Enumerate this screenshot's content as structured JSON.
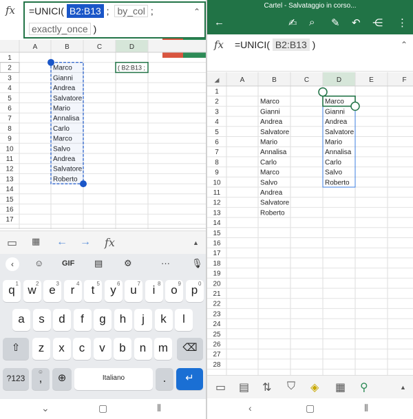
{
  "left": {
    "formula": {
      "fx": "fx",
      "prefix": "=UNICI(",
      "ref": "B2:B13",
      "sep1": ";",
      "arg1": "by_col",
      "sep2": ";",
      "arg2": "exactly_once",
      "close": ")",
      "collapse": "⌃"
    },
    "cancel": "✕",
    "confirm": "✓",
    "columns": [
      "A",
      "B",
      "C",
      "D"
    ],
    "rows": [
      "1",
      "2",
      "3",
      "4",
      "5",
      "6",
      "7",
      "8",
      "9",
      "10",
      "11",
      "12",
      "13",
      "14",
      "15",
      "16",
      "17"
    ],
    "names": [
      "Marco",
      "Gianni",
      "Andrea",
      "Salvatore",
      "Mario",
      "Annalisa",
      "Carlo",
      "Marco",
      "Salvo",
      "Andrea",
      "Salvatore",
      "Roberto"
    ],
    "d2_preview": "( B2:B13 ;",
    "keyboard": {
      "top": {
        "gif": "GIF",
        "more": "···"
      },
      "row1": [
        {
          "k": "q",
          "s": "1"
        },
        {
          "k": "w",
          "s": "2"
        },
        {
          "k": "e",
          "s": "3"
        },
        {
          "k": "r",
          "s": "4"
        },
        {
          "k": "t",
          "s": "5"
        },
        {
          "k": "y",
          "s": "6"
        },
        {
          "k": "u",
          "s": "7"
        },
        {
          "k": "i",
          "s": "8"
        },
        {
          "k": "o",
          "s": "9"
        },
        {
          "k": "p",
          "s": "0"
        }
      ],
      "row2": [
        "a",
        "s",
        "d",
        "f",
        "g",
        "h",
        "j",
        "k",
        "l"
      ],
      "row3": [
        "z",
        "x",
        "c",
        "v",
        "b",
        "n",
        "m"
      ],
      "sym": "?123",
      "comma": ",",
      "space": "Italiano",
      "period": "."
    }
  },
  "right": {
    "title": "Cartel - Salvataggio in corso...",
    "formula": {
      "fx": "fx",
      "prefix": "=UNICI(",
      "ref": "B2:B13",
      "close": ")",
      "collapse": "⌃"
    },
    "columns": [
      "A",
      "B",
      "C",
      "D",
      "E",
      "F"
    ],
    "rows": [
      "1",
      "2",
      "3",
      "4",
      "5",
      "6",
      "7",
      "8",
      "9",
      "10",
      "11",
      "12",
      "13",
      "14",
      "15",
      "16",
      "17",
      "18",
      "19",
      "20",
      "21",
      "22",
      "23",
      "24",
      "25",
      "26",
      "27",
      "28"
    ],
    "names": [
      "Marco",
      "Gianni",
      "Andrea",
      "Salvatore",
      "Mario",
      "Annalisa",
      "Carlo",
      "Marco",
      "Salvo",
      "Andrea",
      "Salvatore",
      "Roberto"
    ],
    "unique": [
      "Marco",
      "Gianni",
      "Andrea",
      "Salvatore",
      "Mario",
      "Annalisa",
      "Carlo",
      "Salvo",
      "Roberto"
    ]
  },
  "colors": {
    "excel_green": "#217346",
    "selection_blue": "#1a56c8",
    "cancel_red": "#d9553f"
  }
}
